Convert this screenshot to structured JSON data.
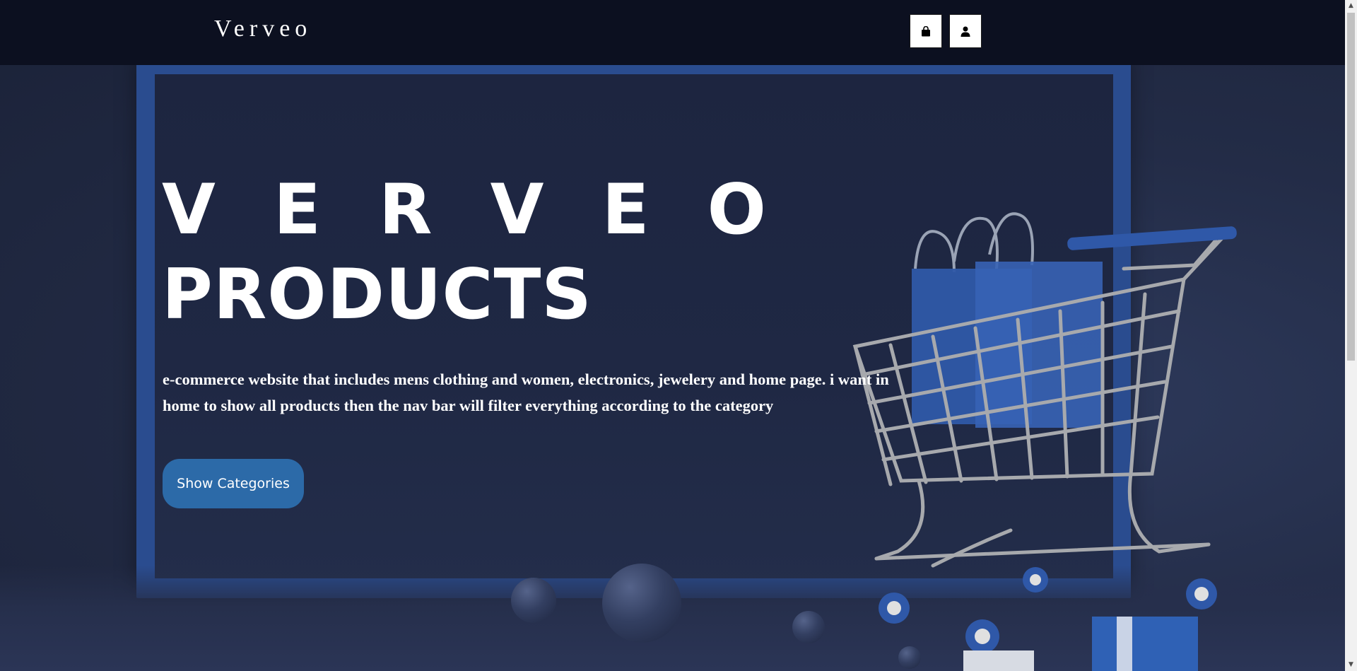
{
  "header": {
    "logo": "Verveo",
    "bag_icon": "shopping-bag-icon",
    "user_icon": "user-icon"
  },
  "hero": {
    "title_line1": "V E R V E O",
    "title_line2": "PRODUCTS",
    "description": "e-commerce website that includes mens clothing and women, electronics, jewelery and home page. i want in home to show all products then the nav bar will filter everything according to the category",
    "cta_label": "Show Categories"
  },
  "colors": {
    "topbar": "#0c1020",
    "hero_background": "#232c47",
    "frame": "#2a4c8f",
    "cta": "#2c6aa8",
    "text": "#ffffff"
  }
}
